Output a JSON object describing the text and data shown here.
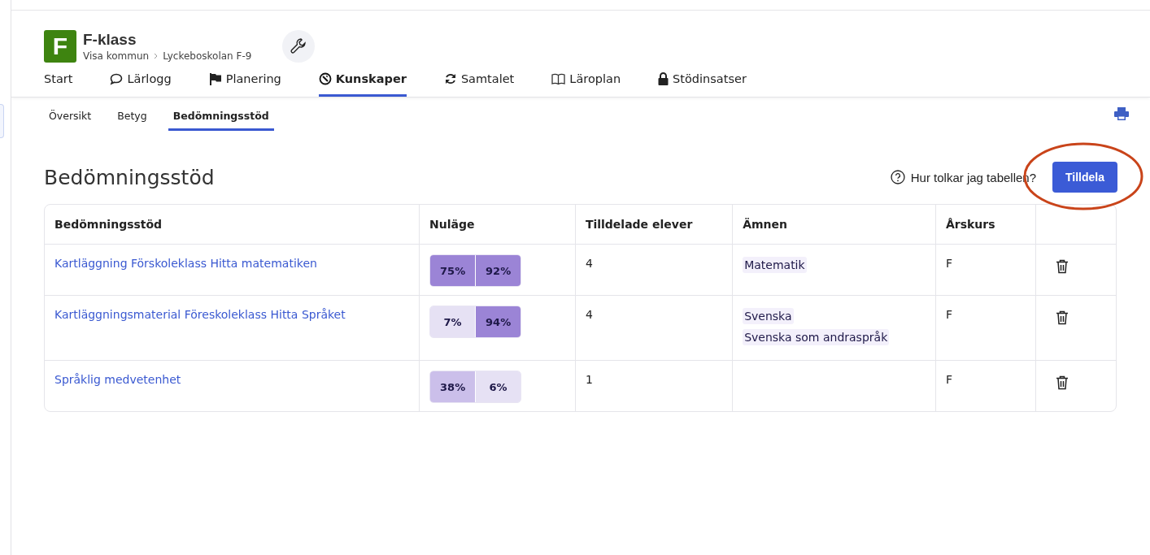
{
  "class_header": {
    "logo_letter": "F",
    "title": "F-klass",
    "breadcrumb": [
      "Visa kommun",
      "Lyckeboskolan F-9"
    ]
  },
  "main_nav": [
    {
      "label": "Start",
      "selected": false
    },
    {
      "label": "Lärlogg",
      "selected": false
    },
    {
      "label": "Planering",
      "selected": false
    },
    {
      "label": "Kunskaper",
      "selected": true
    },
    {
      "label": "Samtalet",
      "selected": false
    },
    {
      "label": "Läroplan",
      "selected": false
    },
    {
      "label": "Stödinsatser",
      "selected": false
    }
  ],
  "sub_nav": [
    {
      "label": "Översikt",
      "selected": false
    },
    {
      "label": "Betyg",
      "selected": false
    },
    {
      "label": "Bedömningsstöd",
      "selected": true
    }
  ],
  "page_title": "Bedömningsstöd",
  "help_link": "Hur tolkar jag tabellen?",
  "assign_button": "Tilldela",
  "highlight_circle": true,
  "table": {
    "columns": [
      "Bedömningsstöd",
      "Nuläge",
      "Tilldelade elever",
      "Ämnen",
      "Årskurs"
    ],
    "rows": [
      {
        "name": "Kartläggning Förskoleklass Hitta matematiken",
        "status": [
          {
            "text": "75%",
            "color": "#9b84d6"
          },
          {
            "text": "92%",
            "color": "#9b84d6"
          }
        ],
        "students": "4",
        "subjects": [
          "Matematik"
        ],
        "grade": "F"
      },
      {
        "name": "Kartläggningsmaterial Föreskoleklass Hitta Språket",
        "status": [
          {
            "text": "7%",
            "color": "#e6e1f4"
          },
          {
            "text": "94%",
            "color": "#9b84d6"
          }
        ],
        "students": "4",
        "subjects": [
          "Svenska",
          "Svenska som andraspråk"
        ],
        "grade": "F"
      },
      {
        "name": "Språklig medvetenhet",
        "status": [
          {
            "text": "38%",
            "color": "#cbbfea"
          },
          {
            "text": "6%",
            "color": "#e6e1f4"
          }
        ],
        "students": "1",
        "subjects": [],
        "grade": "F"
      }
    ]
  }
}
